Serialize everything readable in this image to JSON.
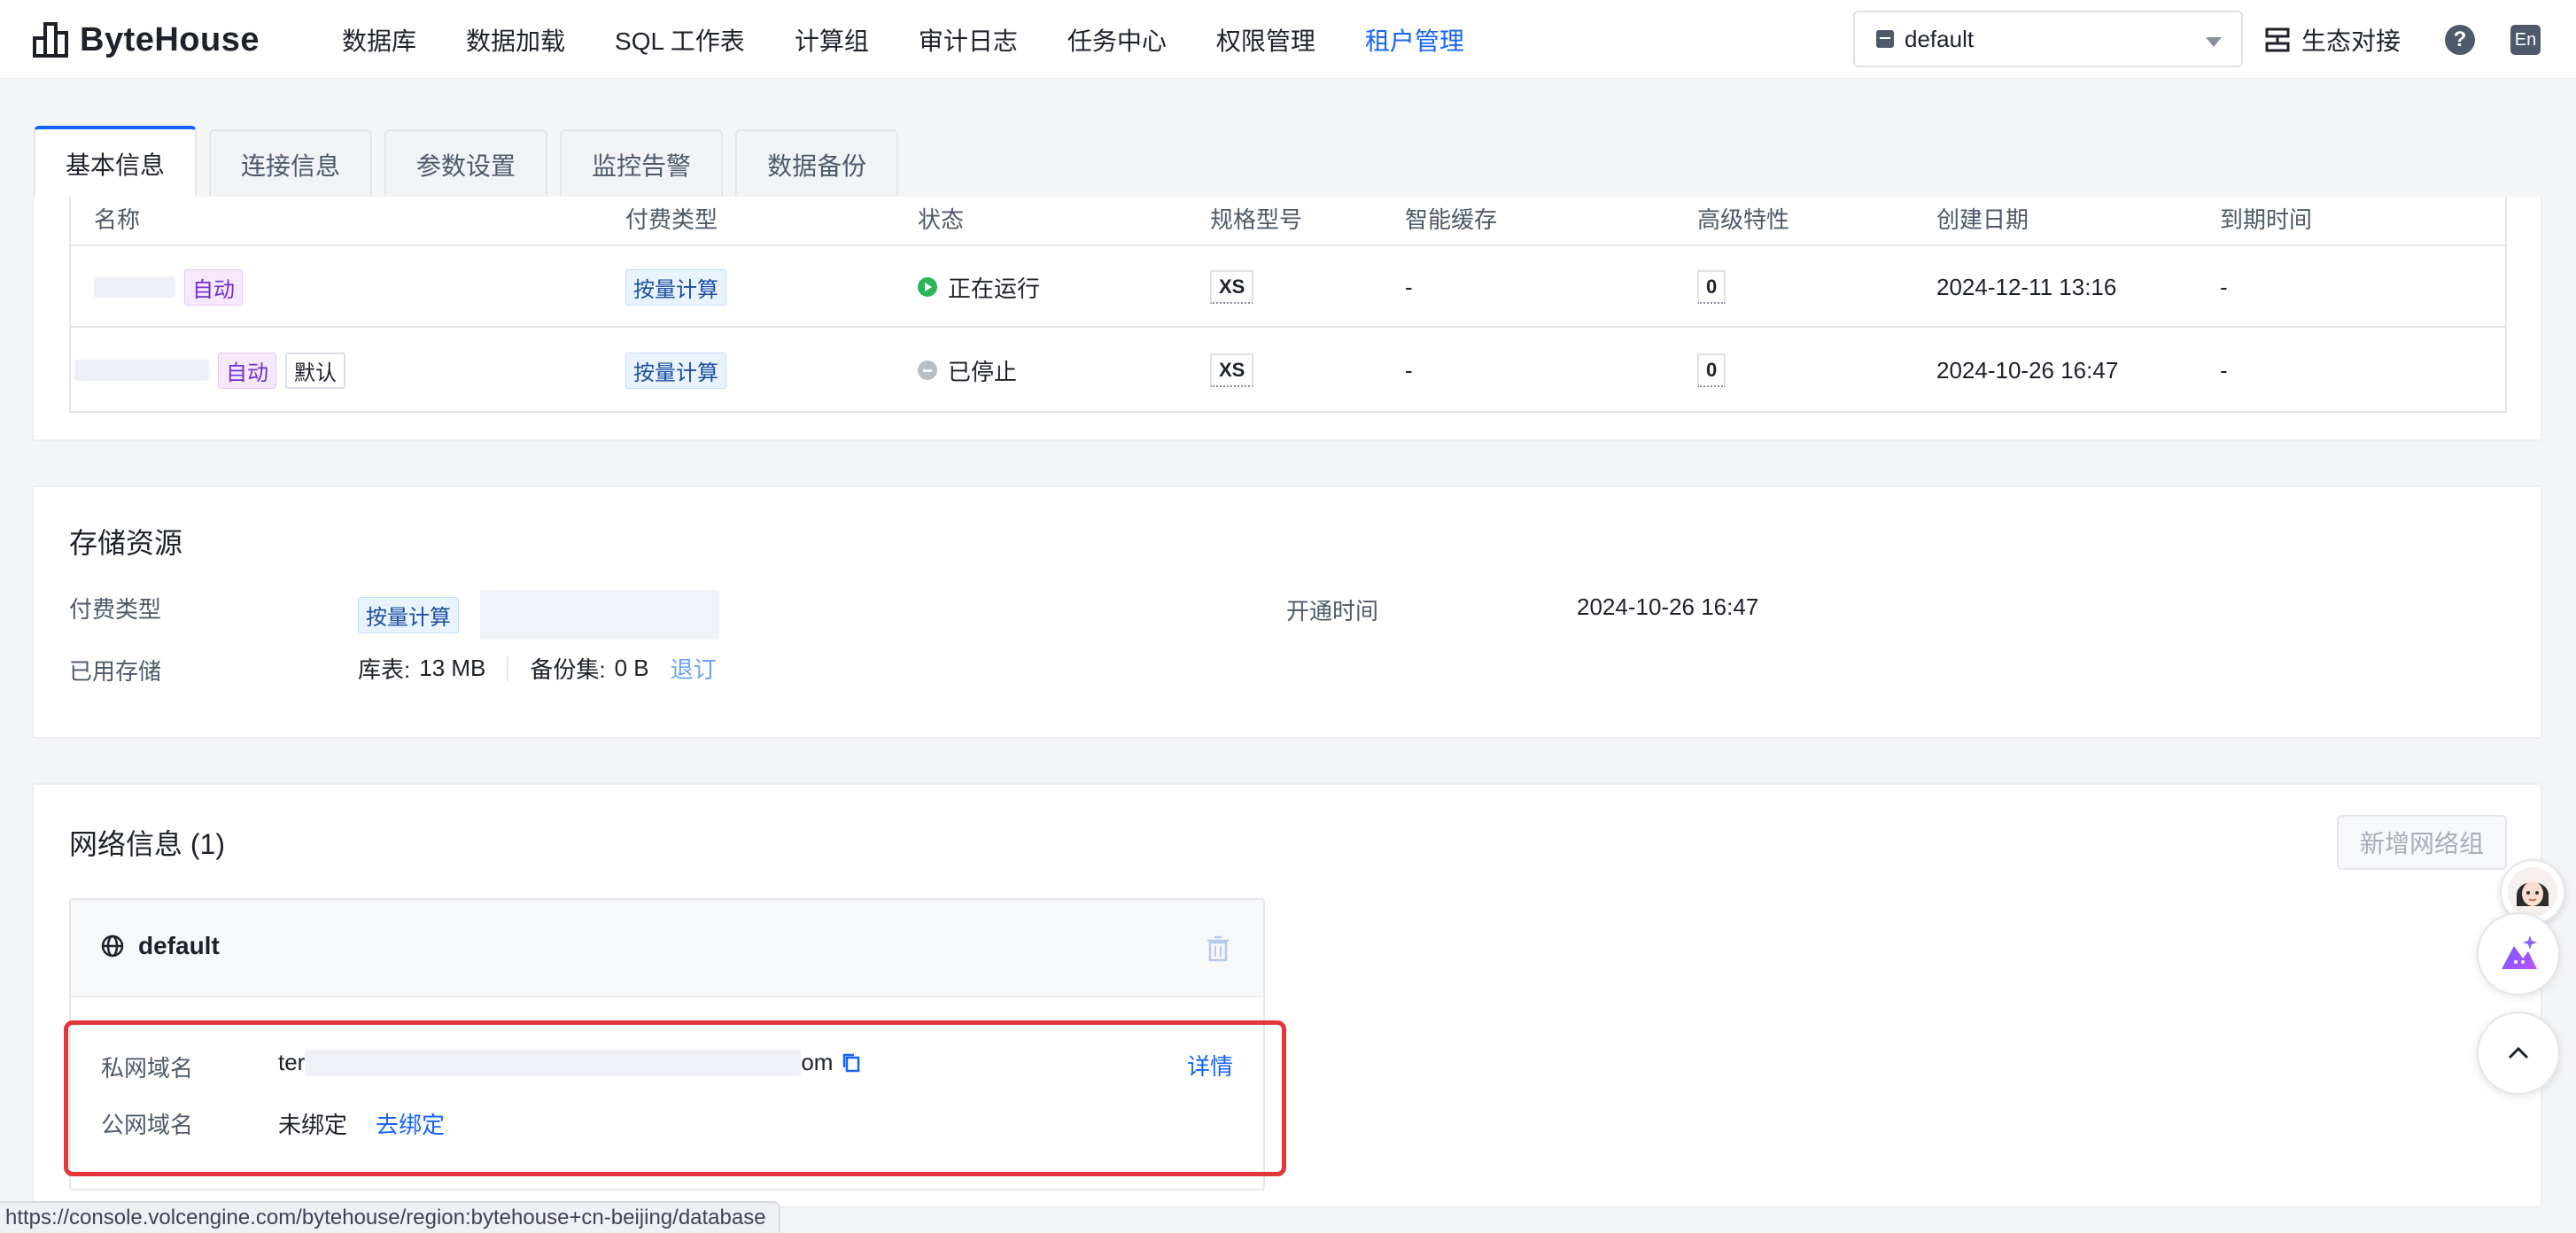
{
  "app": {
    "name": "ByteHouse"
  },
  "nav": {
    "items": [
      "数据库",
      "数据加载",
      "SQL 工作表",
      "计算组",
      "审计日志",
      "任务中心",
      "权限管理",
      "租户管理"
    ],
    "active_index": 7
  },
  "workspace": {
    "selected": "default"
  },
  "header": {
    "eco_label": "生态对接",
    "help": "?",
    "lang": "En"
  },
  "tabs": [
    "基本信息",
    "连接信息",
    "参数设置",
    "监控告警",
    "数据备份"
  ],
  "compute_table": {
    "columns": [
      "名称",
      "付费类型",
      "状态",
      "规格型号",
      "智能缓存",
      "高级特性",
      "创建日期",
      "到期时间"
    ],
    "rows": [
      {
        "tags": [
          "自动"
        ],
        "pay_type": "按量计算",
        "status": "正在运行",
        "status_kind": "running",
        "spec": "XS",
        "cache": "-",
        "advanced": "0",
        "created": "2024-12-11 13:16",
        "expire": "-"
      },
      {
        "tags": [
          "自动",
          "默认"
        ],
        "pay_type": "按量计算",
        "status": "已停止",
        "status_kind": "stopped",
        "spec": "XS",
        "cache": "-",
        "advanced": "0",
        "created": "2024-10-26 16:47",
        "expire": "-"
      }
    ]
  },
  "storage": {
    "title": "存储资源",
    "pay_type_label": "付费类型",
    "pay_type_value": "按量计算",
    "open_time_label": "开通时间",
    "open_time_value": "2024-10-26 16:47",
    "used_label": "已用存储",
    "tables_label": "库表:",
    "tables_value": "13 MB",
    "backup_label": "备份集:",
    "backup_value": "0 B",
    "unsubscribe": "退订"
  },
  "network": {
    "title": "网络信息 (1)",
    "add_button": "新增网络组",
    "group_name": "default",
    "private_domain_label": "私网域名",
    "private_domain_prefix": "ter",
    "private_domain_suffix": "om",
    "detail_link": "详情",
    "public_domain_label": "公网域名",
    "public_domain_value": "未绑定",
    "bind_link": "去绑定"
  },
  "status_url": "https://console.volcengine.com/bytehouse/region:bytehouse+cn-beijing/database",
  "colors": {
    "accent": "#1664ff",
    "highlight": "#e2363a",
    "running": "#2bb55a"
  }
}
